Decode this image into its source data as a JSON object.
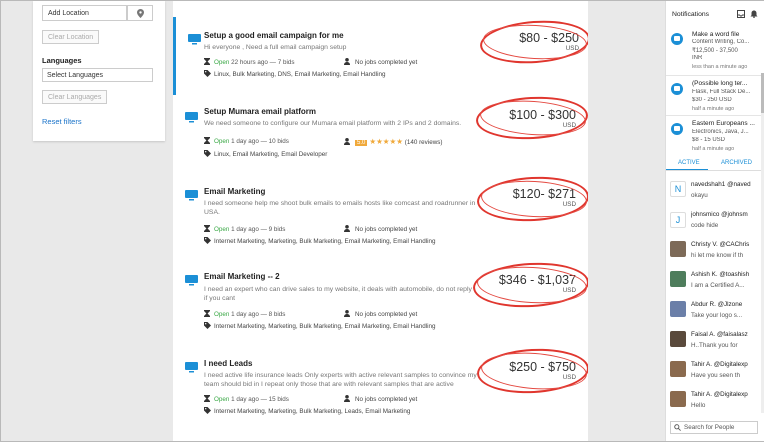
{
  "filters": {
    "location_placeholder": "Add Location",
    "clear_location": "Clear Location",
    "languages_label": "Languages",
    "languages_placeholder": "Select Languages",
    "clear_languages": "Clear Languages",
    "reset": "Reset filters"
  },
  "jobs": [
    {
      "title": "Setup a good email campaign for me",
      "desc": "Hi everyone , Need a full email campaign setup",
      "status": "Open",
      "meta": "22 hours ago  —  7 bids",
      "tags": "Linux, Bulk Marketing, DNS, Email Marketing, Email Handling",
      "jobs_completed": "No jobs completed yet",
      "price": "$80 - $250",
      "currency": "USD"
    },
    {
      "title": "Setup Mumara email platform",
      "desc": "We need someone to configure our Mumara email platform with 2 IPs and 2 domains.",
      "status": "Open",
      "meta": "1 day ago  —  10 bids",
      "tags": "Linux, Email Marketing, Email Developer",
      "rating": "5.0",
      "stars": "★★★★★",
      "reviews": "(140 reviews)",
      "price": "$100 - $300",
      "currency": "USD"
    },
    {
      "title": "Email Marketing",
      "desc": "I need someone help me shoot bulk emails to emails hosts like comcast and roadrunner in USA.",
      "status": "Open",
      "meta": "1 day ago  —  9 bids",
      "tags": "Internet Marketing, Marketing, Bulk Marketing, Email Marketing, Email Handling",
      "jobs_completed": "No jobs completed yet",
      "price": "$120- $271",
      "currency": "USD"
    },
    {
      "title": "Email Marketing -- 2",
      "desc": "I need an expert who can drive sales to my website, it deals with automobile, do not reply if you cant",
      "status": "Open",
      "meta": "1 day ago  —  8 bids",
      "tags": "Internet Marketing, Marketing, Bulk Marketing, Email Marketing, Email Handling",
      "jobs_completed": "No jobs completed yet",
      "price": "$346 - $1,037",
      "currency": "USD"
    },
    {
      "title": "I need Leads",
      "desc": "I need active life insurance leads Only experts with active relevant samples to convince my team should bid in I repeat only those that are with relevant samples that are active California",
      "status": "Open",
      "meta": "1 day ago  —  15 bids",
      "tags": "Internet Marketing, Marketing, Bulk Marketing, Leads, Email Marketing",
      "jobs_completed": "No jobs completed yet",
      "price": "$250 - $750",
      "currency": "USD"
    }
  ],
  "notifications": {
    "header": "Notifications",
    "items": [
      {
        "title": "Make a word file",
        "sub1": "Content Writing, Co...",
        "sub2": "₹12,500 - 37,500",
        "sub3": "INR",
        "time": "less than a minute ago"
      },
      {
        "title": "(Possible long ter...",
        "sub1": "Flask, Full Stack De...",
        "sub2": "$30 - 250 USD",
        "time": "half a minute ago"
      },
      {
        "title": "Eastern Europeans ...",
        "sub1": "Electronics, Java, J...",
        "sub2": "$8 - 15 USD",
        "time": "half a minute ago"
      }
    ],
    "tab_active": "ACTIVE",
    "tab_archived": "ARCHIVED",
    "people": [
      {
        "name": "navedshah1 @naved",
        "msg": "okayu",
        "initial": "N"
      },
      {
        "name": "johnsmico @johnsm",
        "msg": "code hide",
        "initial": "J"
      },
      {
        "name": "Christy V. @CAChris",
        "msg": "hi let me know if th"
      },
      {
        "name": "Ashish K. @toashish",
        "msg": "I am a Certified A..."
      },
      {
        "name": "Abdur R. @Jlzone",
        "msg": "Take your logo s..."
      },
      {
        "name": "Faisal A. @faisalasz",
        "msg": "H..Thank you for"
      },
      {
        "name": "Tahir A. @Digitalexp",
        "msg": "Have you seen th"
      },
      {
        "name": "Tahir A. @Digitalexp",
        "msg": "Hello"
      }
    ],
    "search_placeholder": "Search for People"
  }
}
